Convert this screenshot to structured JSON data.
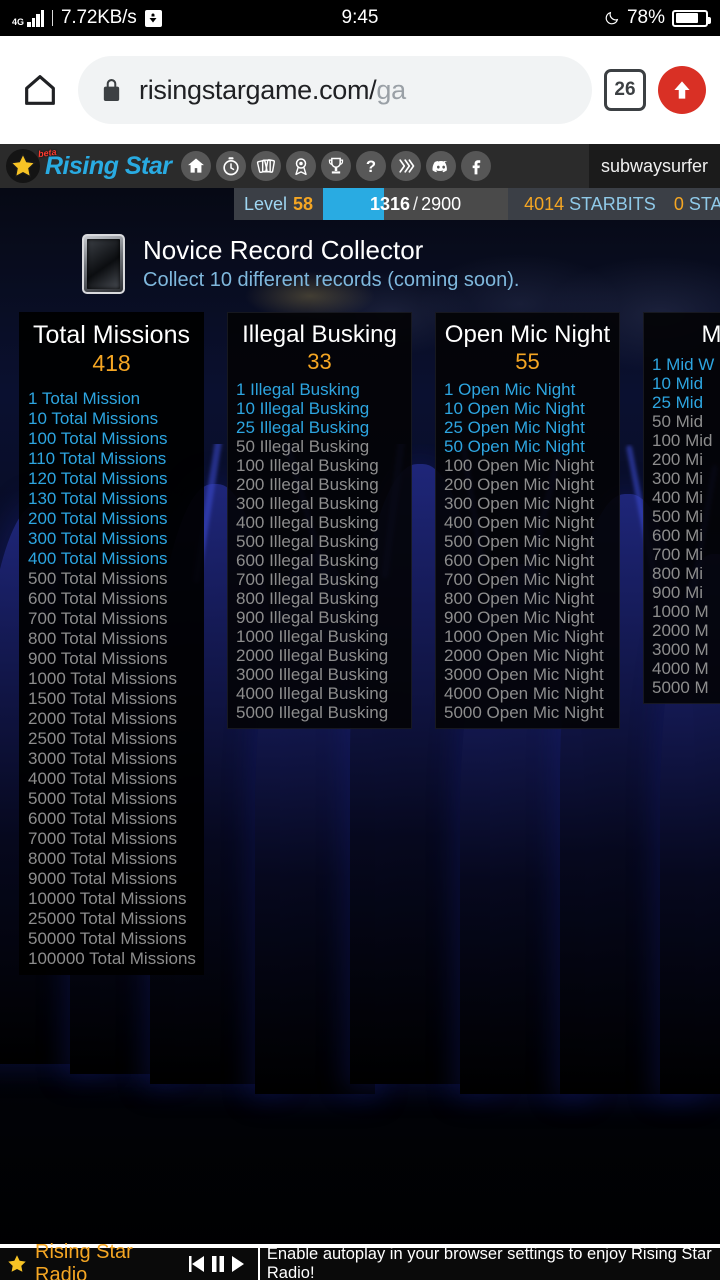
{
  "status_bar": {
    "network_type": "4G",
    "speed": "7.72KB/s",
    "time": "9:45",
    "battery_percent": "78%"
  },
  "browser": {
    "url_visible": "risingstargame.com/ga",
    "url_bright": "risingstargame.com/",
    "url_dim": "ga",
    "tab_count": "26"
  },
  "game_nav": {
    "brand": "Rising Star",
    "beta_badge": "beta",
    "icons": [
      {
        "name": "home-icon",
        "label": "Home"
      },
      {
        "name": "stopwatch-icon",
        "label": "Missions"
      },
      {
        "name": "cards-icon",
        "label": "Cards"
      },
      {
        "name": "ribbon-icon",
        "label": "Achievements"
      },
      {
        "name": "trophy-icon",
        "label": "Leaderboard"
      },
      {
        "name": "question-icon",
        "label": "Help"
      },
      {
        "name": "hive-icon",
        "label": "Hive"
      },
      {
        "name": "discord-icon",
        "label": "Discord"
      },
      {
        "name": "facebook-icon",
        "label": "Facebook"
      }
    ],
    "username": "subwaysurfer"
  },
  "stats": {
    "level_label": "Level",
    "level_value": "58",
    "xp_current": "1316",
    "xp_separator": "/",
    "xp_max": "2900",
    "starbits_amount": "4014",
    "starbits_label": "STARBITS",
    "starpro_amount": "0",
    "starpro_label": "STARPRO"
  },
  "achievement": {
    "title": "Novice Record Collector",
    "subtitle": "Collect 10 different records (coming soon)."
  },
  "cards": [
    {
      "title": "Total Missions",
      "count": "418",
      "items": [
        {
          "label": "1 Total Mission",
          "achieved": true
        },
        {
          "label": "10 Total Missions",
          "achieved": true
        },
        {
          "label": "100 Total Missions",
          "achieved": true
        },
        {
          "label": "110 Total Missions",
          "achieved": true
        },
        {
          "label": "120 Total Missions",
          "achieved": true
        },
        {
          "label": "130 Total Missions",
          "achieved": true
        },
        {
          "label": "200 Total Missions",
          "achieved": true
        },
        {
          "label": "300 Total Missions",
          "achieved": true
        },
        {
          "label": "400 Total Missions",
          "achieved": true
        },
        {
          "label": "500 Total Missions",
          "achieved": false
        },
        {
          "label": "600 Total Missions",
          "achieved": false
        },
        {
          "label": "700 Total Missions",
          "achieved": false
        },
        {
          "label": "800 Total Missions",
          "achieved": false
        },
        {
          "label": "900 Total Missions",
          "achieved": false
        },
        {
          "label": "1000 Total Missions",
          "achieved": false
        },
        {
          "label": "1500 Total Missions",
          "achieved": false
        },
        {
          "label": "2000 Total Missions",
          "achieved": false
        },
        {
          "label": "2500 Total Missions",
          "achieved": false
        },
        {
          "label": "3000 Total Missions",
          "achieved": false
        },
        {
          "label": "4000 Total Missions",
          "achieved": false
        },
        {
          "label": "5000 Total Missions",
          "achieved": false
        },
        {
          "label": "6000 Total Missions",
          "achieved": false
        },
        {
          "label": "7000 Total Missions",
          "achieved": false
        },
        {
          "label": "8000 Total Missions",
          "achieved": false
        },
        {
          "label": "9000 Total Missions",
          "achieved": false
        },
        {
          "label": "10000 Total Missions",
          "achieved": false
        },
        {
          "label": "25000 Total Missions",
          "achieved": false
        },
        {
          "label": "50000 Total Missions",
          "achieved": false
        },
        {
          "label": "100000 Total Missions",
          "achieved": false
        }
      ]
    },
    {
      "title": "Illegal Busking",
      "count": "33",
      "items": [
        {
          "label": "1 Illegal Busking",
          "achieved": true
        },
        {
          "label": "10 Illegal Busking",
          "achieved": true
        },
        {
          "label": "25 Illegal Busking",
          "achieved": true
        },
        {
          "label": "50 Illegal Busking",
          "achieved": false
        },
        {
          "label": "100 Illegal Busking",
          "achieved": false
        },
        {
          "label": "200 Illegal Busking",
          "achieved": false
        },
        {
          "label": "300 Illegal Busking",
          "achieved": false
        },
        {
          "label": "400 Illegal Busking",
          "achieved": false
        },
        {
          "label": "500 Illegal Busking",
          "achieved": false
        },
        {
          "label": "600 Illegal Busking",
          "achieved": false
        },
        {
          "label": "700 Illegal Busking",
          "achieved": false
        },
        {
          "label": "800 Illegal Busking",
          "achieved": false
        },
        {
          "label": "900 Illegal Busking",
          "achieved": false
        },
        {
          "label": "1000 Illegal Busking",
          "achieved": false
        },
        {
          "label": "2000 Illegal Busking",
          "achieved": false
        },
        {
          "label": "3000 Illegal Busking",
          "achieved": false
        },
        {
          "label": "4000 Illegal Busking",
          "achieved": false
        },
        {
          "label": "5000 Illegal Busking",
          "achieved": false
        }
      ]
    },
    {
      "title": "Open Mic Night",
      "count": "55",
      "items": [
        {
          "label": "1 Open Mic Night",
          "achieved": true
        },
        {
          "label": "10 Open Mic Night",
          "achieved": true
        },
        {
          "label": "25 Open Mic Night",
          "achieved": true
        },
        {
          "label": "50 Open Mic Night",
          "achieved": true
        },
        {
          "label": "100 Open Mic Night",
          "achieved": false
        },
        {
          "label": "200 Open Mic Night",
          "achieved": false
        },
        {
          "label": "300 Open Mic Night",
          "achieved": false
        },
        {
          "label": "400 Open Mic Night",
          "achieved": false
        },
        {
          "label": "500 Open Mic Night",
          "achieved": false
        },
        {
          "label": "600 Open Mic Night",
          "achieved": false
        },
        {
          "label": "700 Open Mic Night",
          "achieved": false
        },
        {
          "label": "800 Open Mic Night",
          "achieved": false
        },
        {
          "label": "900 Open Mic Night",
          "achieved": false
        },
        {
          "label": "1000 Open Mic Night",
          "achieved": false
        },
        {
          "label": "2000 Open Mic Night",
          "achieved": false
        },
        {
          "label": "3000 Open Mic Night",
          "achieved": false
        },
        {
          "label": "4000 Open Mic Night",
          "achieved": false
        },
        {
          "label": "5000 Open Mic Night",
          "achieved": false
        }
      ]
    },
    {
      "title": "Mid W",
      "count": "",
      "items": [
        {
          "label": "1 Mid W",
          "achieved": true
        },
        {
          "label": "10 Mid ",
          "achieved": true
        },
        {
          "label": "25 Mid ",
          "achieved": true
        },
        {
          "label": "50 Mid ",
          "achieved": false
        },
        {
          "label": "100 Mid",
          "achieved": false
        },
        {
          "label": "200 Mi",
          "achieved": false
        },
        {
          "label": "300 Mi",
          "achieved": false
        },
        {
          "label": "400 Mi",
          "achieved": false
        },
        {
          "label": "500 Mi",
          "achieved": false
        },
        {
          "label": "600 Mi",
          "achieved": false
        },
        {
          "label": "700 Mi",
          "achieved": false
        },
        {
          "label": "800 Mi",
          "achieved": false
        },
        {
          "label": "900 Mi",
          "achieved": false
        },
        {
          "label": "1000 M",
          "achieved": false
        },
        {
          "label": "2000 M",
          "achieved": false
        },
        {
          "label": "3000 M",
          "achieved": false
        },
        {
          "label": "4000 M",
          "achieved": false
        },
        {
          "label": "5000 M",
          "achieved": false
        }
      ]
    }
  ],
  "radio_bar": {
    "title": "Rising Star Radio",
    "message": "Enable autoplay in your browser settings to enjoy Rising Star Radio!"
  },
  "colors": {
    "accent_blue": "#29abe2",
    "achieved": "#2da5e0",
    "unachieved": "#8d8d8d",
    "gold": "#f5a623",
    "browser_red": "#d93025"
  }
}
